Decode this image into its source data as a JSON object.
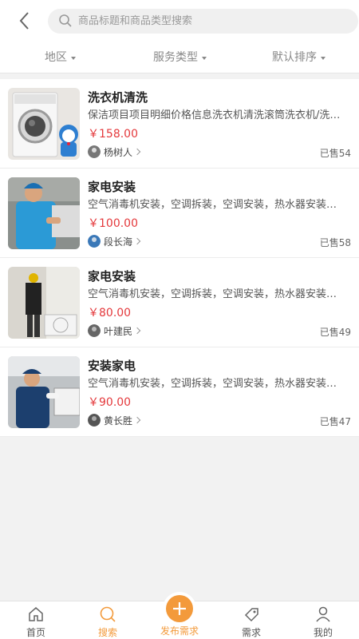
{
  "search": {
    "placeholder": "商品标题和商品类型搜索"
  },
  "filters": [
    {
      "label": "地区"
    },
    {
      "label": "服务类型"
    },
    {
      "label": "默认排序"
    }
  ],
  "items": [
    {
      "title": "洗衣机清洗",
      "desc": "保洁项目项目明细价格信息洗衣机清洗滚筒洗衣机/洗…",
      "price": "￥158.00",
      "seller": "杨树人",
      "sold": "已售54"
    },
    {
      "title": "家电安装",
      "desc": "空气消毒机安装，空调拆装，空调安装，热水器安装…",
      "price": "￥100.00",
      "seller": "段长海",
      "sold": "已售58"
    },
    {
      "title": "家电安装",
      "desc": "空气消毒机安装，空调拆装，空调安装，热水器安装…",
      "price": "￥80.00",
      "seller": "叶建民",
      "sold": "已售49"
    },
    {
      "title": "安装家电",
      "desc": "空气消毒机安装，空调拆装，空调安装，热水器安装…",
      "price": "￥90.00",
      "seller": "黄长胜",
      "sold": "已售47"
    }
  ],
  "tabbar": {
    "home": "首页",
    "search": "搜索",
    "publish": "发布需求",
    "demand": "需求",
    "mine": "我的"
  },
  "colors": {
    "accent": "#f39a3b",
    "price": "#e4393c"
  }
}
